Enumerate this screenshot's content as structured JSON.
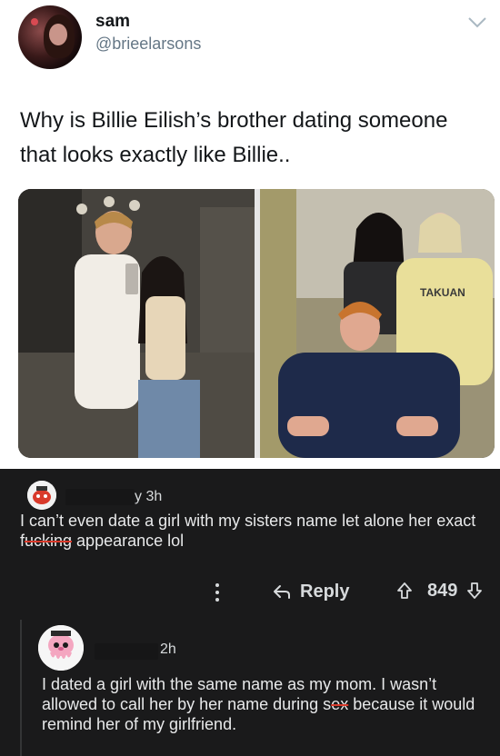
{
  "tweet": {
    "display_name": "sam",
    "handle": "@brieelarsons",
    "text": "Why is Billie Eilish’s brother dating someone that looks exactly like Billie..",
    "photo_count": 2
  },
  "comments": [
    {
      "time": "y 3h",
      "text_part1": "I can’t even date a girl with my sisters name let alone her exact f",
      "text_strike": "ucking",
      "text_part2": " appearance lol",
      "reply_label": "Reply",
      "votes": "849"
    },
    {
      "time": "2h",
      "text_part1": "I dated a girl with the same name as my mom. I wasn’t allowed to call her by her name during s",
      "text_strike": "ex",
      "text_part2": " because it would remind her of my girlfriend."
    }
  ],
  "colors": {
    "dark_bg": "#1a1a1b",
    "handle_gray": "#657786",
    "censor_red": "#d93a2b"
  },
  "icons": [
    "chevron-down-icon",
    "more-options-icon",
    "reply-icon",
    "upvote-icon",
    "downvote-icon"
  ]
}
